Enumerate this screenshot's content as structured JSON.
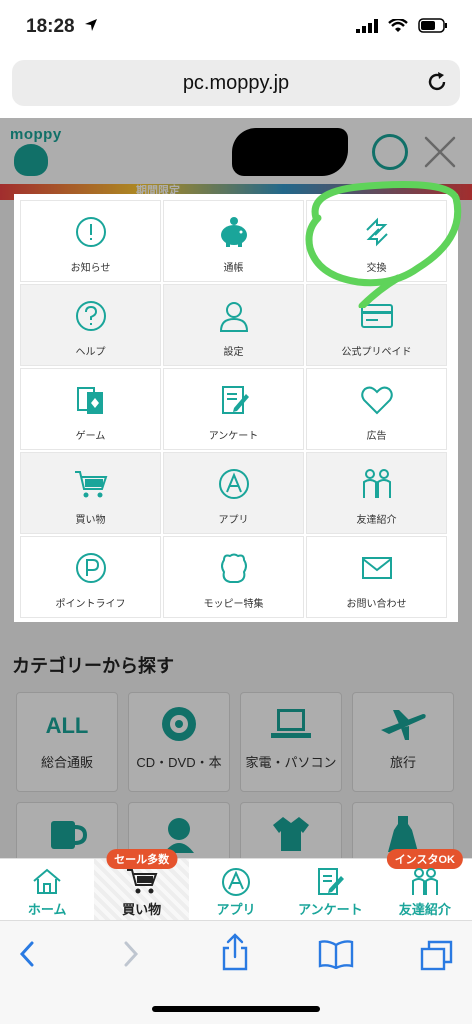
{
  "status": {
    "time": "18:28"
  },
  "browser": {
    "url": "pc.moppy.jp"
  },
  "site": {
    "logo": "moppy",
    "banner_text": "期間限定",
    "category_title": "カテゴリーから探す",
    "categories": [
      {
        "label": "総合通販",
        "icon": "all-text",
        "icon_text": "ALL"
      },
      {
        "label": "CD・DVD・本",
        "icon": "disc-icon"
      },
      {
        "label": "家電・パソコン",
        "icon": "laptop-icon"
      },
      {
        "label": "旅行",
        "icon": "airplane-icon"
      },
      {
        "label": "",
        "icon": "mug-icon"
      },
      {
        "label": "",
        "icon": "person-icon"
      },
      {
        "label": "",
        "icon": "shirt-icon"
      },
      {
        "label": "",
        "icon": "dress-icon"
      }
    ]
  },
  "menu": {
    "items": [
      {
        "label": "お知らせ",
        "icon": "notice-icon"
      },
      {
        "label": "通帳",
        "icon": "piggy-bank-icon"
      },
      {
        "label": "交換",
        "icon": "exchange-icon"
      },
      {
        "label": "ヘルプ",
        "icon": "help-icon"
      },
      {
        "label": "設定",
        "icon": "user-icon"
      },
      {
        "label": "公式プリペイド",
        "icon": "card-icon"
      },
      {
        "label": "ゲーム",
        "icon": "cards-icon"
      },
      {
        "label": "アンケート",
        "icon": "survey-icon"
      },
      {
        "label": "広告",
        "icon": "heart-icon"
      },
      {
        "label": "買い物",
        "icon": "cart-icon"
      },
      {
        "label": "アプリ",
        "icon": "app-a-icon"
      },
      {
        "label": "友達紹介",
        "icon": "friends-icon"
      },
      {
        "label": "ポイントライフ",
        "icon": "point-p-icon"
      },
      {
        "label": "モッピー特集",
        "icon": "mascot-icon"
      },
      {
        "label": "お問い合わせ",
        "icon": "mail-icon"
      }
    ]
  },
  "tabbar": {
    "tabs": [
      {
        "label": "ホーム",
        "badge": ""
      },
      {
        "label": "買い物",
        "badge": "セール多数"
      },
      {
        "label": "アプリ",
        "badge": ""
      },
      {
        "label": "アンケート",
        "badge": ""
      },
      {
        "label": "友達紹介",
        "badge": "インスタOK"
      }
    ]
  },
  "colors": {
    "accent": "#1aa59a",
    "badge": "#e5532d",
    "annotation": "#5fd35a"
  }
}
